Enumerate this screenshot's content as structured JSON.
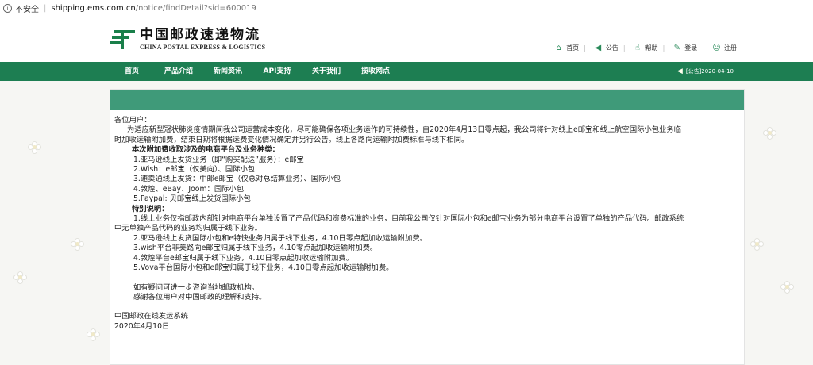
{
  "browser": {
    "security_label": "不安全",
    "url_host": "shipping.ems.com.cn",
    "url_path": "/notice/findDetail?sid=600019"
  },
  "header": {
    "logo_cn": "中国邮政速递物流",
    "logo_en": "CHINA POSTAL EXPRESS & LOGISTICS",
    "links": [
      {
        "label": "首页",
        "icon": "home-icon"
      },
      {
        "label": "公告",
        "icon": "speaker-icon"
      },
      {
        "label": "帮助",
        "icon": "thumb-icon"
      },
      {
        "label": "登录",
        "icon": "pencil-icon"
      },
      {
        "label": "注册",
        "icon": "user-icon"
      }
    ]
  },
  "nav": {
    "items": [
      "首页",
      "产品介绍",
      "新闻资讯",
      "API支持",
      "关于我们",
      "揽收网点"
    ],
    "notice": "[公告]2020-04-10"
  },
  "article": {
    "greeting": "各位用户：",
    "intro_1": "为适应新型冠状肺炎疫情期间我公司运营成本变化，尽可能确保各项业务运作的可持续性，自2020年4月13日零点起，我公司将针对线上e邮宝和线上航空国际小包业务临",
    "intro_2": "时加收运输附加费，结束日期将根据运费变化情况确定并另行公告。线上各路向运输附加费标准与线下相同。",
    "scope_title": "本次附加费收取涉及的电商平台及业务种类：",
    "scope_items": [
      "1.亚马逊线上发货业务（即“购买配送”服务）：e邮宝",
      "2.Wish：e邮宝（仅美向）、国际小包",
      "3.速卖通线上发货：中邮e邮宝（仅总对总结算业务）、国际小包",
      "4.敦煌、eBay、Joom：国际小包",
      "5.Paypal: 贝邮宝线上发货国际小包"
    ],
    "notes_title": "特别说明：",
    "note_1a": "1.线上业务仅指邮政内部针对电商平台单独设置了产品代码和资费标准的业务，目前我公司仅针对国际小包和e邮宝业务为部分电商平台设置了单独的产品代码。邮政系统",
    "note_1b": "中无单独产品代码的业务均归属于线下业务。",
    "notes": [
      "2.亚马逊线上发货国际小包和e特快业务归属于线下业务，4.10日零点起加收运输附加费。",
      "3.wish平台非美路向e邮宝归属于线下业务，4.10零点起加收运输附加费。",
      "4.敦煌平台e邮宝归属于线下业务，4.10日零点起加收运输附加费。",
      "5.Vova平台国际小包和e邮宝归属于线下业务，4.10日零点起加收运输附加费。"
    ],
    "closing_1": "如有疑问可进一步咨询当地邮政机构。",
    "closing_2": "感谢各位用户对中国邮政的理解和支持。",
    "signature": "中国邮政在线发运系统",
    "date": "2020年4月10日"
  },
  "colors": {
    "nav_green": "#1d7e52",
    "panel_bar": "#3f9a79",
    "background": "#f6f6f3"
  }
}
